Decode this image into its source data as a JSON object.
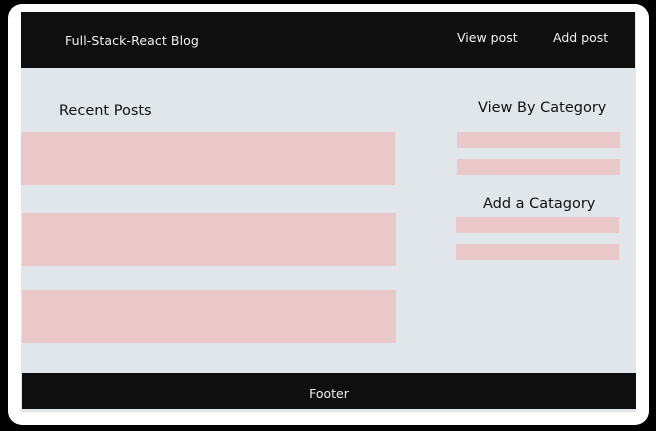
{
  "header": {
    "brand": "Full-Stack-React Blog",
    "nav": {
      "view_post": "View post",
      "add_post": "Add post"
    }
  },
  "main": {
    "recent_posts_heading": "Recent Posts"
  },
  "sidebar": {
    "view_by_category_heading": "View By Category",
    "add_category_heading": "Add a Catagory"
  },
  "footer": {
    "text": "Footer"
  },
  "colors": {
    "header_bg": "#0f0f10",
    "page_bg": "#e1e6ea",
    "placeholder": "#eac8c9"
  }
}
